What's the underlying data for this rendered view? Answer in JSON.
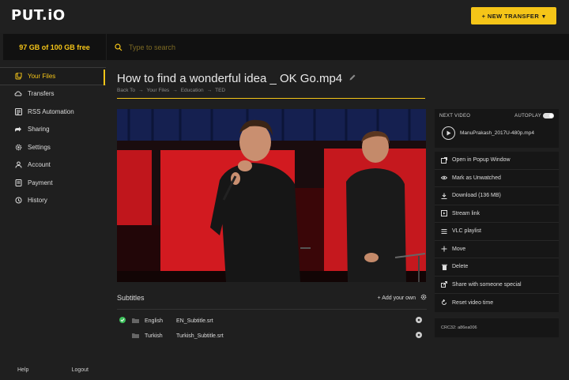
{
  "header": {
    "logo": "PUT.iO",
    "new_transfer_label": "+ NEW TRANSFER",
    "new_transfer_caret": "▾"
  },
  "storage": {
    "text": "97 GB of 100 GB free"
  },
  "search": {
    "placeholder": "Type to search"
  },
  "sidebar": {
    "items": [
      {
        "label": "Your Files",
        "icon": "files-icon",
        "active": true
      },
      {
        "label": "Transfers",
        "icon": "transfers-icon"
      },
      {
        "label": "RSS Automation",
        "icon": "rss-icon"
      },
      {
        "label": "Sharing",
        "icon": "sharing-icon"
      },
      {
        "label": "Settings",
        "icon": "gear-icon"
      },
      {
        "label": "Account",
        "icon": "user-icon"
      },
      {
        "label": "Payment",
        "icon": "payment-icon"
      },
      {
        "label": "History",
        "icon": "history-icon"
      }
    ],
    "footer": {
      "help": "Help",
      "logout": "Logout"
    }
  },
  "main": {
    "title": "How to find a wonderful idea _ OK Go.mp4",
    "breadcrumb": [
      "Back To",
      "Your Files",
      "Education",
      "TED"
    ],
    "subtitles": {
      "title": "Subtitles",
      "add_label": "+ Add your own",
      "rows": [
        {
          "language": "English",
          "file": "EN_Subtitle.srt",
          "selected": true
        },
        {
          "language": "Turkish",
          "file": "Turkish_Subtitle.srt",
          "selected": false
        }
      ]
    }
  },
  "right_panel": {
    "next_video_label": "NEXT VIDEO",
    "autoplay_label": "AUTOPLAY",
    "next_video_name": "ManuPrakash_2017U-480p.mp4",
    "actions": [
      {
        "label": "Open in Popup Window",
        "icon": "popup-icon"
      },
      {
        "label": "Mark as Unwatched",
        "icon": "eye-icon"
      },
      {
        "label": "Download (136 MB)",
        "icon": "download-icon"
      },
      {
        "label": "Stream link",
        "icon": "stream-icon"
      },
      {
        "label": "VLC playlist",
        "icon": "playlist-icon"
      },
      {
        "label": "Move",
        "icon": "move-icon"
      },
      {
        "label": "Delete",
        "icon": "trash-icon"
      },
      {
        "label": "Share with someone special",
        "icon": "share-icon"
      },
      {
        "label": "Reset video time",
        "icon": "reset-icon"
      }
    ],
    "crc": "CRC32: a86ea006"
  },
  "colors": {
    "accent": "#f5c518",
    "background": "#1f1f1f",
    "panel": "#161616"
  }
}
